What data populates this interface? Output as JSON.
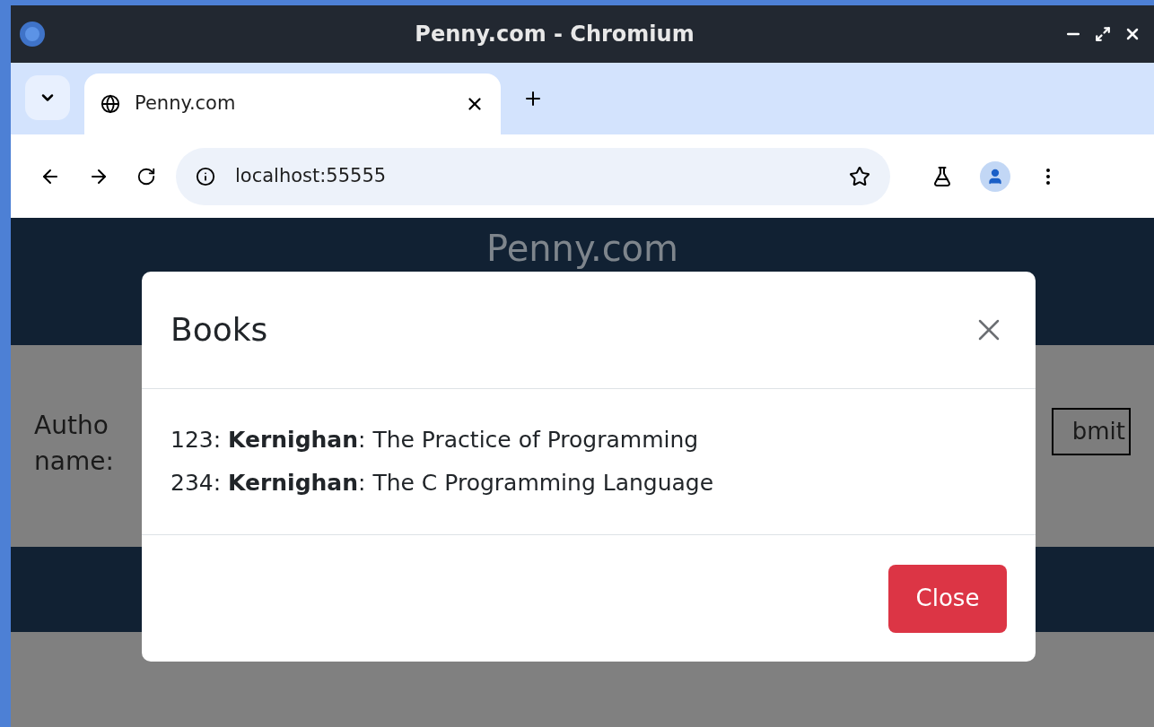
{
  "window": {
    "title": "Penny.com - Chromium"
  },
  "tabs": [
    {
      "label": "Penny.com",
      "selected": true
    }
  ],
  "address_bar": {
    "value": "localhost:55555"
  },
  "page": {
    "header_title": "Penny.com",
    "form_label": [
      "Autho",
      "name:"
    ],
    "submit_button": "bmit"
  },
  "modal": {
    "title": "Books",
    "items": [
      "123: **Kernighan**: The Practice of Programming",
      "234: **Kernighan**: The C Programming Language"
    ],
    "close_button": "Close"
  }
}
